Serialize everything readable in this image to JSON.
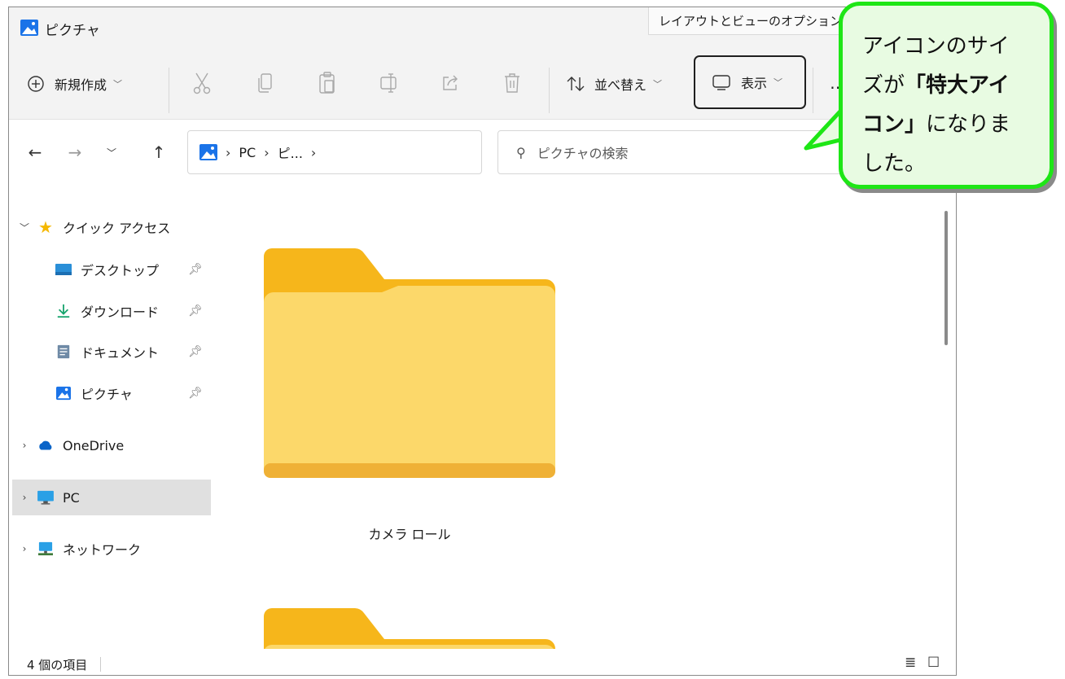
{
  "window": {
    "title": "ピクチャ",
    "tooltip": "レイアウトとビューのオプション。"
  },
  "toolbar": {
    "new_label": "新規作成",
    "sort_label": "並べ替え",
    "view_label": "表示",
    "more_label": "⋯"
  },
  "address": {
    "crumbs": [
      "PC",
      "ピ..."
    ],
    "search_placeholder": "ピクチャの検索"
  },
  "nav": {
    "quick_access": "クイック アクセス",
    "items": [
      {
        "label": "デスクトップ",
        "icon": "desktop-icon"
      },
      {
        "label": "ダウンロード",
        "icon": "download-icon"
      },
      {
        "label": "ドキュメント",
        "icon": "document-icon"
      },
      {
        "label": "ピクチャ",
        "icon": "pictures-icon"
      }
    ],
    "onedrive": "OneDrive",
    "pc": "PC",
    "network": "ネットワーク"
  },
  "content": {
    "folders": [
      "カメラ ロール"
    ]
  },
  "status": {
    "item_count": "4 個の項目"
  },
  "callout": {
    "line1": "アイコンのサイ",
    "line2_pre": "ズが",
    "line2_bold": "「特大アイ",
    "line3_bold": "コン」",
    "line3_post": "になりま",
    "line4": "した。"
  },
  "colors": {
    "callout_border": "#1ee616",
    "callout_fill": "#e8fbe2",
    "folder_back": "#f6b61b",
    "folder_front": "#fcd86a"
  }
}
